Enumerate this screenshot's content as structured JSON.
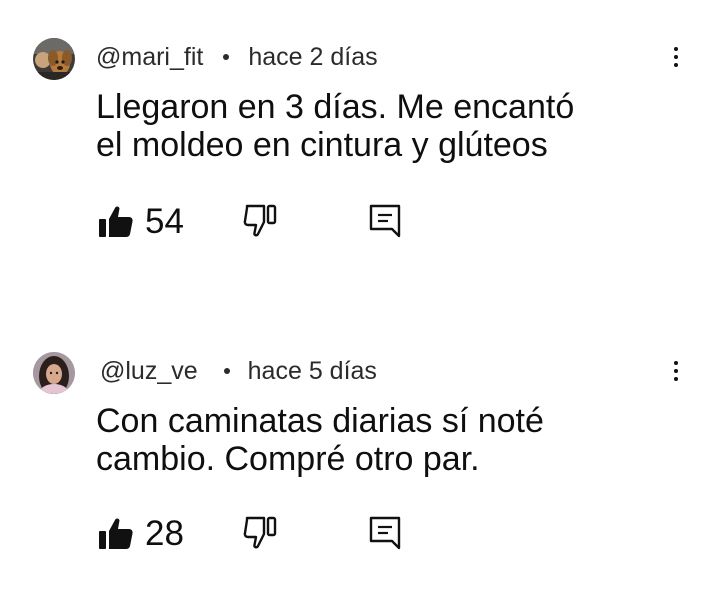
{
  "comments": [
    {
      "handle": "@mari_fit",
      "time": "hace 2 días",
      "text_lines": [
        "Llegaron en 3 días. Me encantó",
        "el moldeo en cintura y glúteos"
      ],
      "likes": "54",
      "avatar_icon": "dog-avatar"
    },
    {
      "handle": "@luz_ve",
      "time": "hace 5 días",
      "text_lines": [
        "Con caminatas diarias sí noté",
        "cambio. Compré otro par."
      ],
      "likes": "28",
      "avatar_icon": "woman-avatar"
    }
  ],
  "icons": {
    "like": "thumbs-up-icon",
    "dislike": "thumbs-down-icon",
    "reply": "comment-icon",
    "menu": "more-vertical-icon"
  },
  "colors": {
    "text": "#0f0f0f",
    "meta": "#2b2b2b",
    "background": "#ffffff"
  }
}
